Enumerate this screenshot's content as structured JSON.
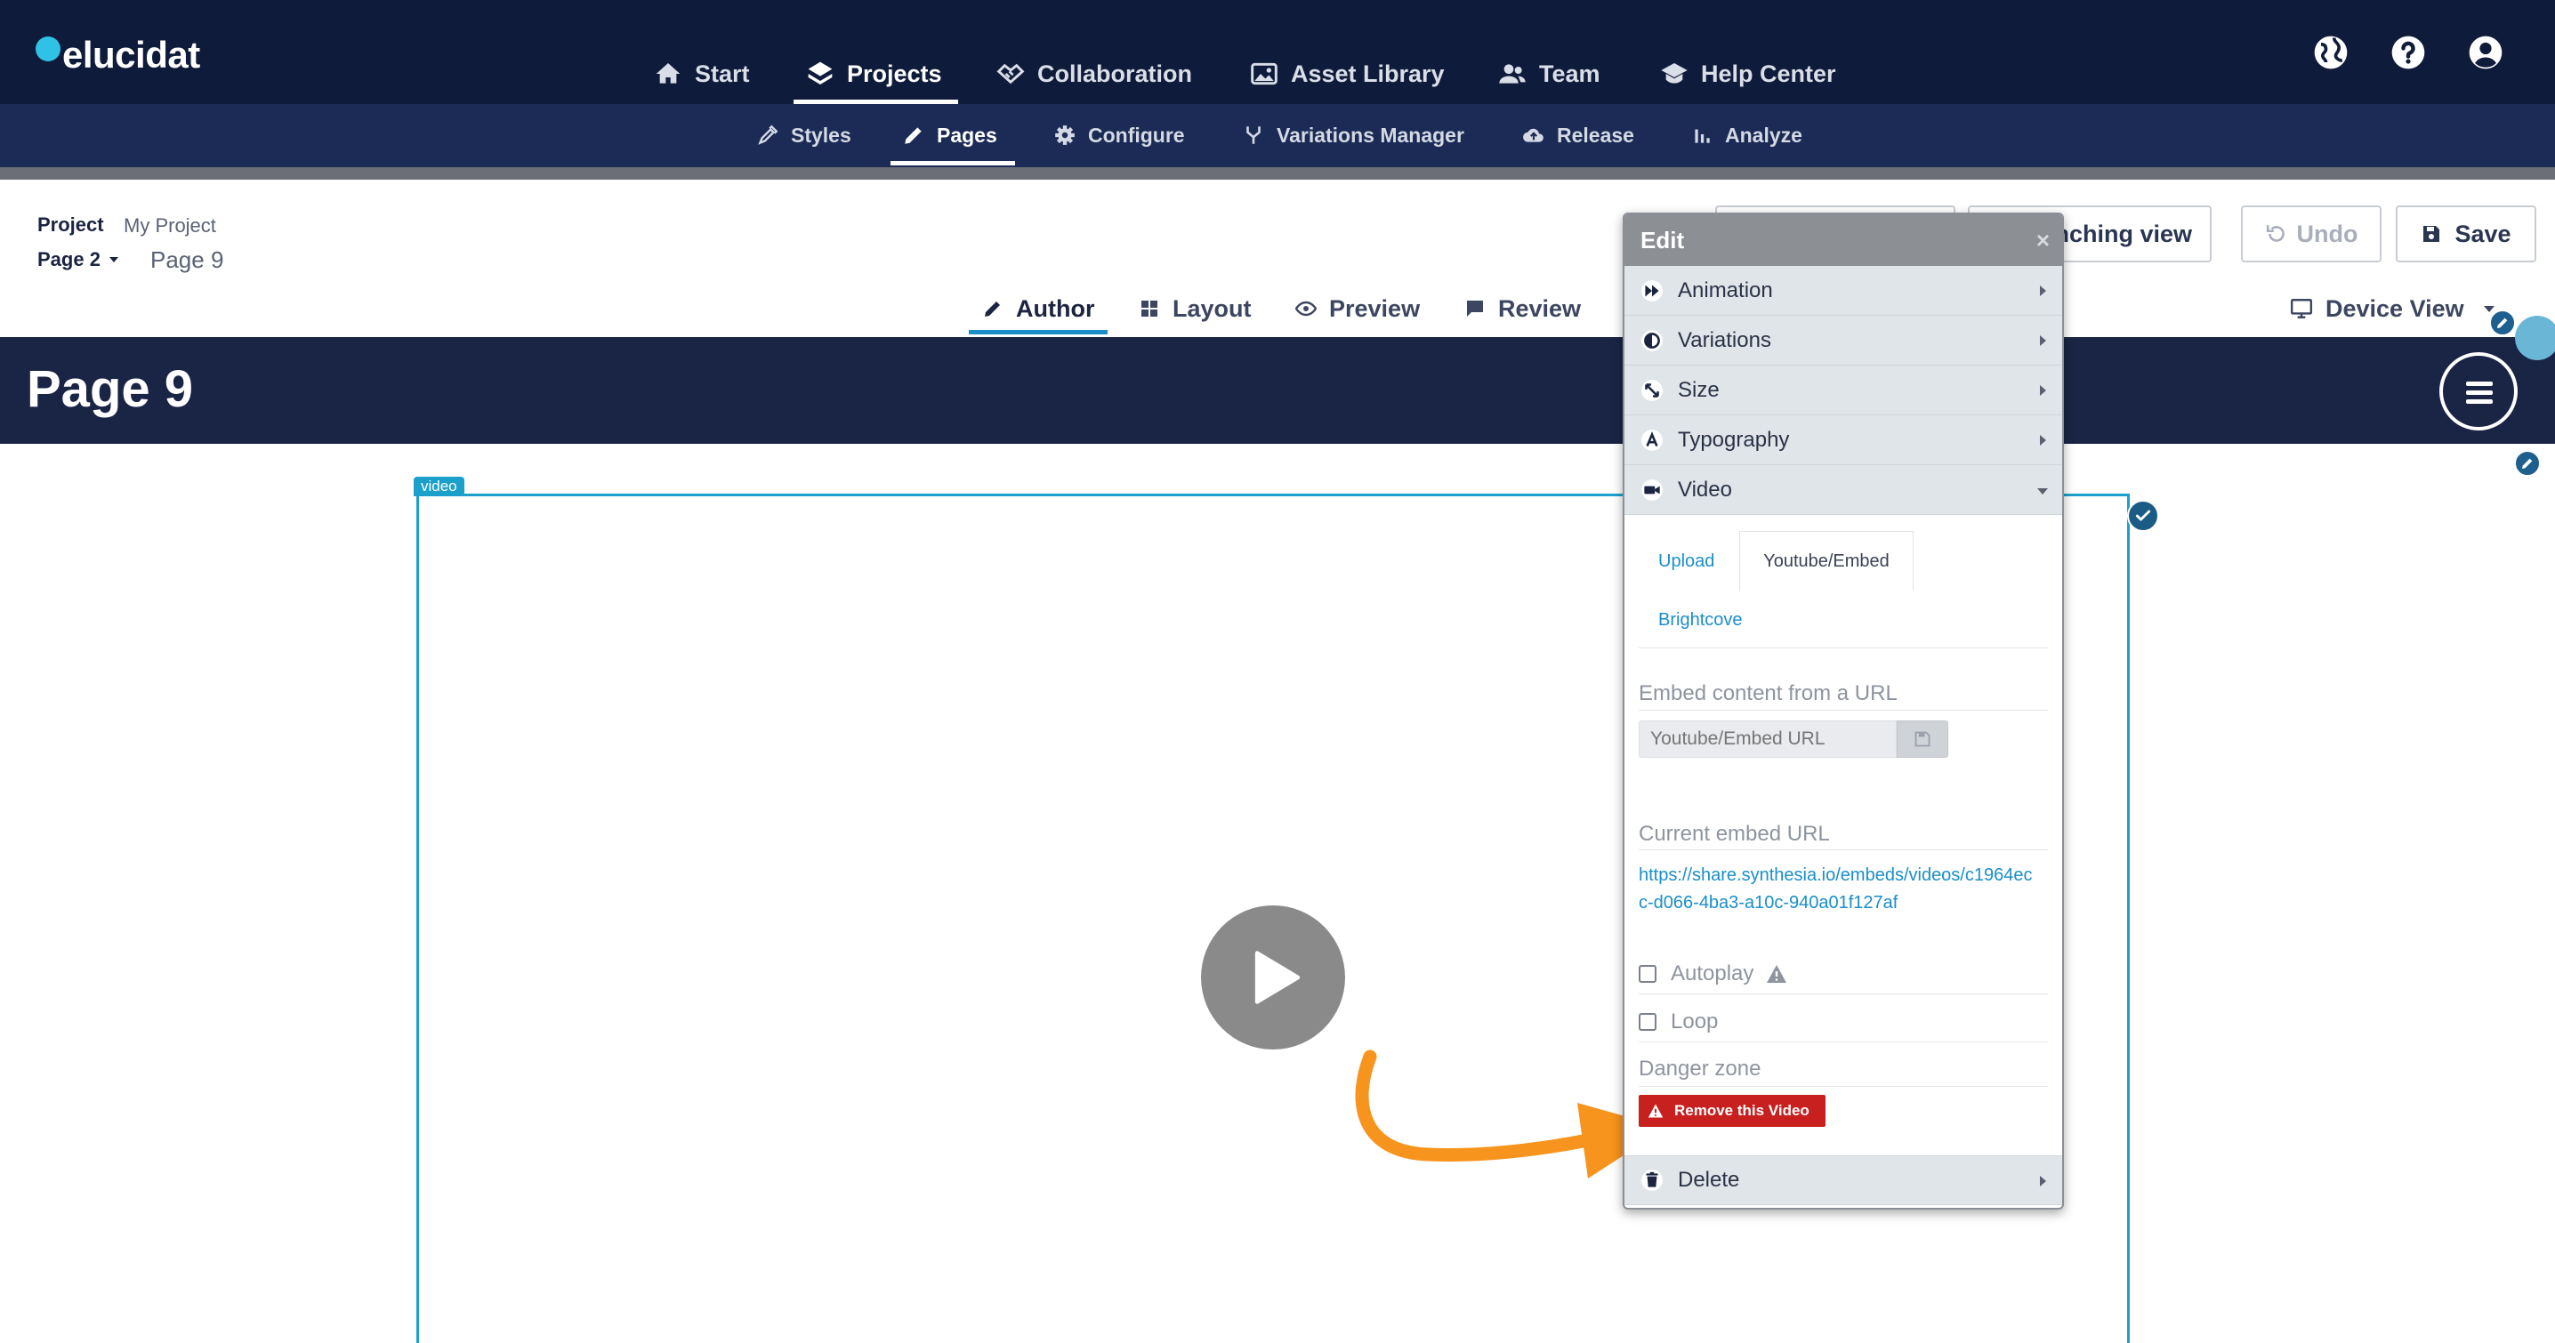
{
  "app": {
    "logo_text": "elucidat"
  },
  "top_nav": {
    "items": [
      {
        "label": "Start",
        "icon": "home-icon"
      },
      {
        "label": "Projects",
        "icon": "layers-icon",
        "active": true
      },
      {
        "label": "Collaboration",
        "icon": "handshake-icon"
      },
      {
        "label": "Asset Library",
        "icon": "images-icon"
      },
      {
        "label": "Team",
        "icon": "users-icon"
      },
      {
        "label": "Help Center",
        "icon": "graduation-cap-icon"
      }
    ],
    "right_icons": [
      "globe-icon",
      "help-icon",
      "user-circle-icon"
    ]
  },
  "sub_nav": {
    "items": [
      {
        "label": "Styles",
        "icon": "eyedropper-icon"
      },
      {
        "label": "Pages",
        "icon": "pencil-icon",
        "active": true
      },
      {
        "label": "Configure",
        "icon": "gear-icon"
      },
      {
        "label": "Variations Manager",
        "icon": "branch-icon"
      },
      {
        "label": "Release",
        "icon": "cloud-upload-icon"
      },
      {
        "label": "Analyze",
        "icon": "bar-chart-icon"
      }
    ]
  },
  "project_header": {
    "project_label": "Project",
    "project_name": "My Project",
    "page_select": "Page 2",
    "page_current": "Page 9",
    "launch_button": "nching view",
    "undo_button": "Undo",
    "save_button": "Save"
  },
  "mode_tabs": {
    "items": [
      {
        "label": "Author",
        "icon": "pencil-icon",
        "active": true
      },
      {
        "label": "Layout",
        "icon": "grid-icon"
      },
      {
        "label": "Preview",
        "icon": "eye-icon"
      },
      {
        "label": "Review",
        "icon": "comment-icon"
      }
    ],
    "device_view": "Device View"
  },
  "page": {
    "title": "Page 9",
    "video_tag": "video"
  },
  "edit_panel": {
    "title": "Edit",
    "close": "×",
    "rows": [
      {
        "label": "Animation",
        "icon": "fast-forward-icon"
      },
      {
        "label": "Variations",
        "icon": "half-circle-icon"
      },
      {
        "label": "Size",
        "icon": "resize-icon"
      },
      {
        "label": "Typography",
        "icon": "font-icon"
      },
      {
        "label": "Video",
        "icon": "video-camera-icon",
        "expanded": true
      }
    ],
    "video": {
      "tabs": [
        "Upload",
        "Youtube/Embed",
        "Brightcove"
      ],
      "active_tab": "Youtube/Embed",
      "embed_label": "Embed content from a URL",
      "embed_placeholder": "Youtube/Embed URL",
      "current_label": "Current embed URL",
      "current_url": "https://share.synthesia.io/embeds/videos/c1964ecc-d066-4ba3-a10c-940a01f127af",
      "autoplay_label": "Autoplay",
      "loop_label": "Loop",
      "danger_label": "Danger zone",
      "remove_button": "Remove this Video"
    },
    "delete_label": "Delete"
  },
  "colors": {
    "top_nav_bg": "#0f1b3a",
    "sub_nav_bg": "#1b2b55",
    "banner_bg": "#1a2445",
    "accent": "#1a8ec9",
    "danger": "#c81f1f",
    "annotation_arrow": "#f7941d"
  }
}
